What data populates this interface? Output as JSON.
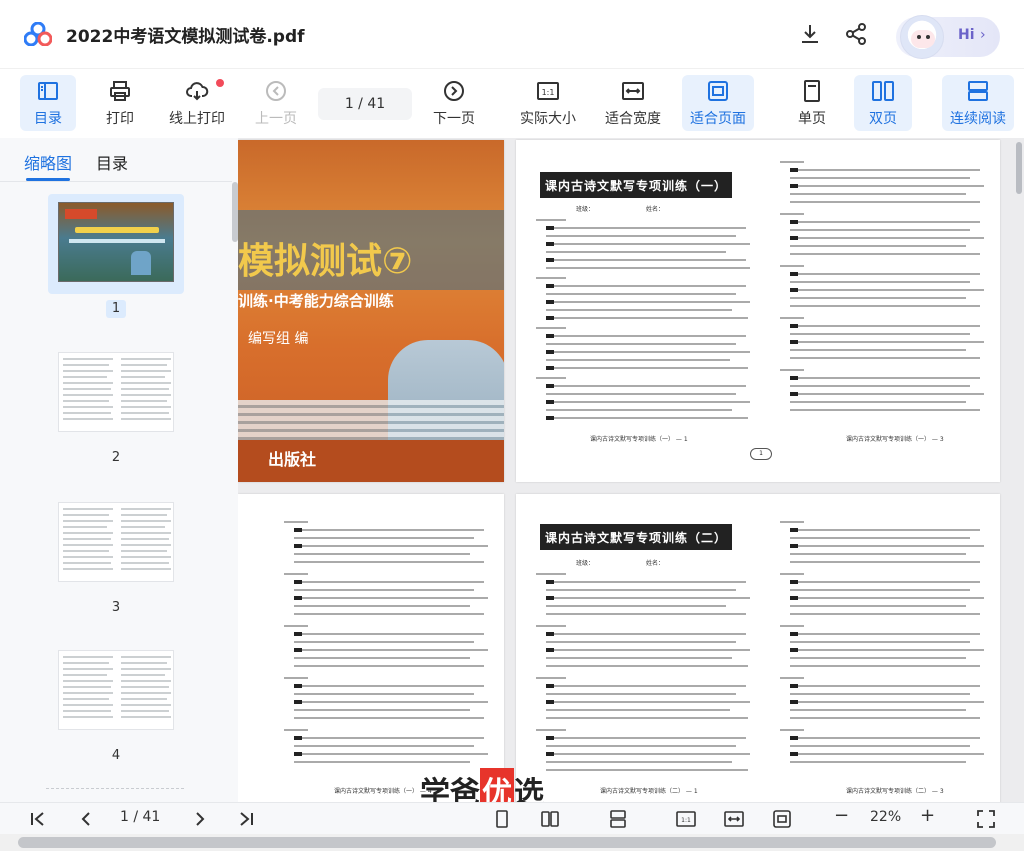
{
  "app": {
    "document_title": "2022中考语文模拟测试卷.pdf",
    "hi_label": "Hi",
    "hi_chevron": "›"
  },
  "toolbar": {
    "toc": "目录",
    "print": "打印",
    "online_print": "线上打印",
    "prev": "上一页",
    "page_indicator": "1 / 41",
    "next": "下一页",
    "actual_size": "实际大小",
    "fit_width": "适合宽度",
    "fit_page": "适合页面",
    "single_page": "单页",
    "double_page": "双页",
    "continuous": "连续阅读",
    "actual_size_icon_text": "1:1"
  },
  "sidebar": {
    "tabs": [
      "缩略图",
      "目录"
    ],
    "active_tab": "缩略图",
    "thumbnails": [
      {
        "number": "1",
        "selected": true
      },
      {
        "number": "2",
        "selected": false
      },
      {
        "number": "3",
        "selected": false
      },
      {
        "number": "4",
        "selected": false
      }
    ]
  },
  "pages": {
    "cover": {
      "title_fragment": "模拟测试⑦",
      "subtitle_fragment": "训练·中考能力综合训练",
      "editor_fragment": "编写组 编",
      "publisher_fragment": "出版社"
    },
    "worksheet1": {
      "title": "课内古诗文默写专项训练（一）",
      "class_label": "班级：",
      "name_label": "姓名：",
      "footer": "课内古诗文默写专项训练（一） — 1",
      "footer_right": "课内古诗文默写专项训练（一） — 3",
      "page_marker": "1"
    },
    "worksheet2": {
      "title": "课内古诗文默写专项训练（二）",
      "class_label": "班级：",
      "name_label": "姓名：",
      "footer_left": "课内古诗文默写专项训练（一） — 4",
      "footer": "课内古诗文默写专项训练（二） — 1",
      "footer_right": "课内古诗文默写专项训练（二） — 3"
    }
  },
  "bottombar": {
    "page_indicator": "1 / 41",
    "zoom": "22%",
    "zoom_minus": "−",
    "zoom_plus": "+",
    "actual_size_text": "1:1"
  },
  "watermark": {
    "part1": "学爸",
    "part2": "优",
    "part3": "选"
  },
  "colors": {
    "accent": "#1f72e0",
    "active_bg": "#e8f1fd",
    "notification": "#f24b5a"
  }
}
